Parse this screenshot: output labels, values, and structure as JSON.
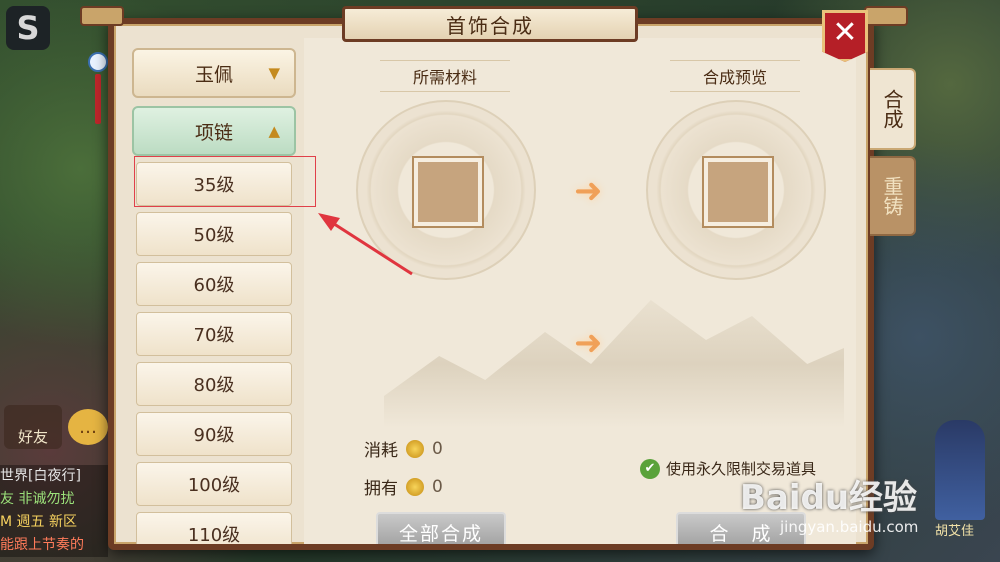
{
  "window": {
    "title": "首饰合成"
  },
  "categories": [
    {
      "label": "玉佩",
      "expanded": false
    },
    {
      "label": "项链",
      "expanded": true
    }
  ],
  "levels": [
    "35级",
    "50级",
    "60级",
    "70级",
    "80级",
    "90级",
    "100级",
    "110级"
  ],
  "selected_level": "35级",
  "sections": {
    "materials_label": "所需材料",
    "preview_label": "合成预览"
  },
  "costs": {
    "consume_label": "消耗",
    "consume_value": "0",
    "own_label": "拥有",
    "own_value": "0"
  },
  "option": {
    "label": "使用永久限制交易道具",
    "checked": true
  },
  "buttons": {
    "combine_all": "全部合成",
    "combine": "合　成"
  },
  "tabs": [
    {
      "label": "合成",
      "active": true
    },
    {
      "label": "重铸",
      "active": false
    }
  ],
  "close_label": "✕",
  "left_hud": {
    "friend_label": "好友",
    "chat_lines": [
      "世界[白夜行]",
      "友 非诚勿扰",
      "M 週五 新区",
      "能跟上节奏的"
    ]
  },
  "npc_name": "胡艾佳",
  "watermark": {
    "brand": "Baidu经验",
    "url": "jingyan.baidu.com"
  },
  "colors": {
    "frame": "#6d3c24",
    "accent_red": "#b51f27",
    "selected_green": "#bcdcc3"
  }
}
